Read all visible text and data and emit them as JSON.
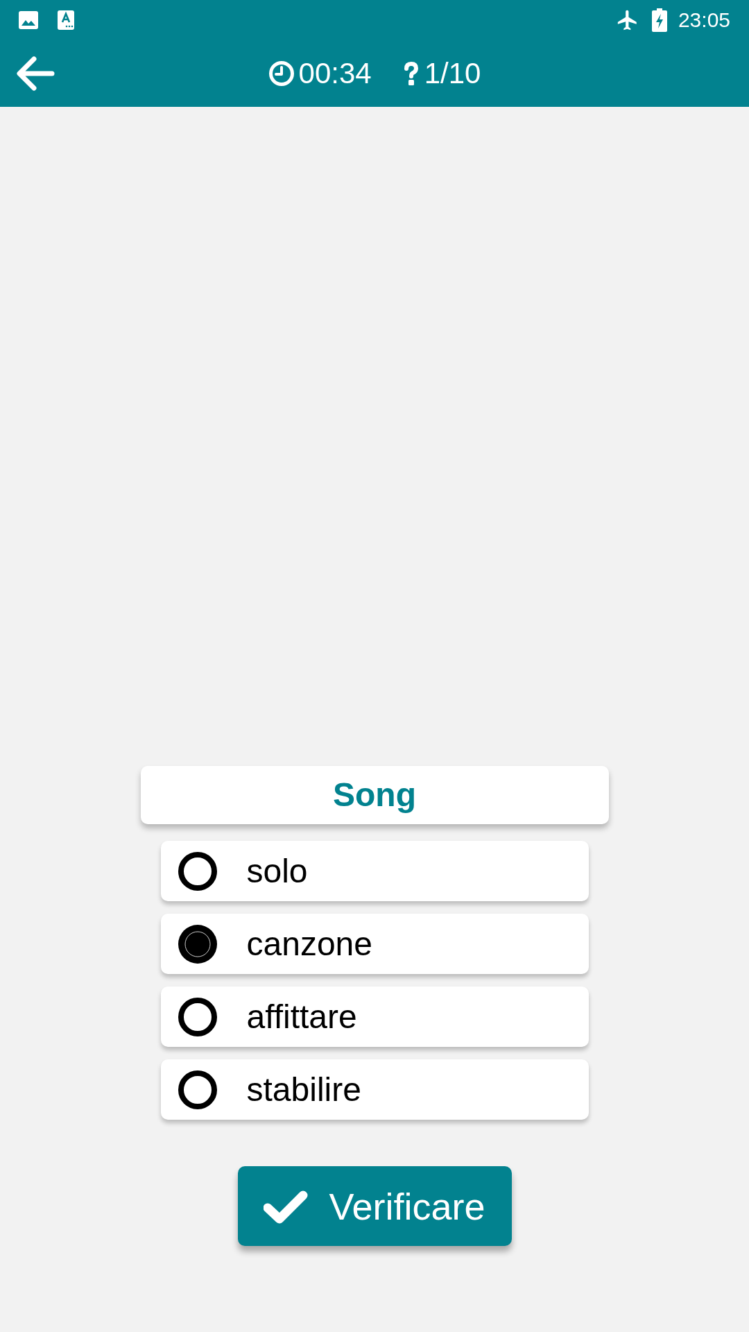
{
  "status_bar": {
    "time": "23:05"
  },
  "header": {
    "timer": "00:34",
    "progress": "1/10"
  },
  "question": {
    "word": "Song"
  },
  "options": [
    {
      "label": "solo",
      "selected": false
    },
    {
      "label": "canzone",
      "selected": true
    },
    {
      "label": "affittare",
      "selected": false
    },
    {
      "label": "stabilire",
      "selected": false
    }
  ],
  "check_button": {
    "label": "Verificare"
  }
}
